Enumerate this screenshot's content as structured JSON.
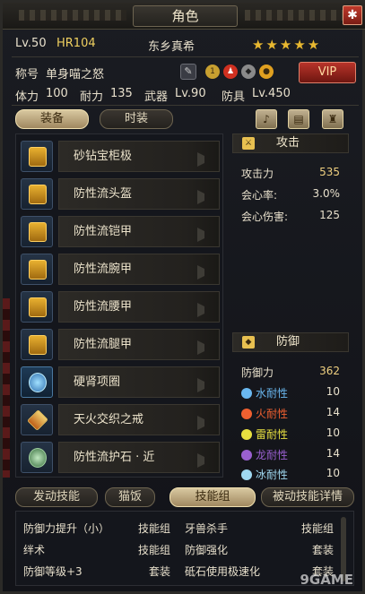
{
  "window": {
    "title": "角色",
    "close_glyph": "✱"
  },
  "header": {
    "level": "Lv.50",
    "hr": "HR104",
    "name": "东乡真希",
    "stars": "★★★★★",
    "title_label": "称号",
    "title_value": "单身喵之怒",
    "vip": "VIP",
    "stamina_label": "体力",
    "stamina": "100",
    "endurance_label": "耐力",
    "endurance": "135",
    "weapon_label": "武器",
    "weapon_lv": "Lv.90",
    "armor_label": "防具",
    "armor_lv": "Lv.450"
  },
  "tabs": {
    "equip": "装备",
    "fashion": "时装"
  },
  "equipment": [
    {
      "name": "砂钻宝柜极",
      "icon": "weapon-icon"
    },
    {
      "name": "防性流头盔",
      "icon": "helmet-icon"
    },
    {
      "name": "防性流铠甲",
      "icon": "chest-icon"
    },
    {
      "name": "防性流腕甲",
      "icon": "arm-icon"
    },
    {
      "name": "防性流腰甲",
      "icon": "waist-icon"
    },
    {
      "name": "防性流腿甲",
      "icon": "leg-icon"
    },
    {
      "name": "硬肾项圈",
      "icon": "necklace-icon"
    },
    {
      "name": "天火交织之戒",
      "icon": "ring-icon"
    },
    {
      "name": "防性流护石 · 近",
      "icon": "charm-icon"
    }
  ],
  "attack": {
    "heading": "攻击",
    "rows": [
      {
        "label": "攻击力",
        "value": "535"
      },
      {
        "label": "会心率:",
        "value": "3.0%"
      },
      {
        "label": "会心伤害:",
        "value": "125"
      }
    ]
  },
  "defense": {
    "heading": "防御",
    "rows": [
      {
        "label": "防御力",
        "value": "362"
      },
      {
        "label": "水耐性",
        "value": "10",
        "color": "#6ab8f0"
      },
      {
        "label": "火耐性",
        "value": "14",
        "color": "#f06030"
      },
      {
        "label": "雷耐性",
        "value": "10",
        "color": "#e8e040"
      },
      {
        "label": "龙耐性",
        "value": "14",
        "color": "#9a60d0"
      },
      {
        "label": "冰耐性",
        "value": "10",
        "color": "#a0d8f0"
      }
    ]
  },
  "bottom_tabs": {
    "active_skill": "发动技能",
    "cat": "猫饭",
    "skill_group": "技能组",
    "passive_detail": "被动技能详情"
  },
  "skills": [
    {
      "name": "防御力提升（小）",
      "type": "技能组"
    },
    {
      "name": "牙兽杀手",
      "type": "技能组"
    },
    {
      "name": "绊术",
      "type": "技能组"
    },
    {
      "name": "防御强化",
      "type": "套装"
    },
    {
      "name": "防御等级+3",
      "type": "套装"
    },
    {
      "name": "砥石使用极速化",
      "type": "套装"
    }
  ],
  "watermark": "9GAME"
}
